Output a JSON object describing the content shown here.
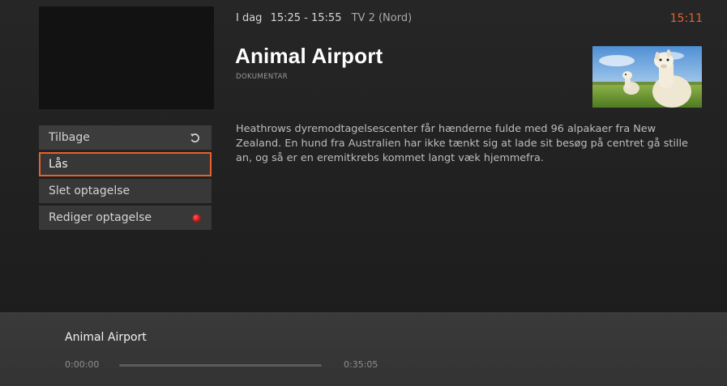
{
  "header": {
    "day": "I dag",
    "time_range": "15:25 - 15:55",
    "channel": "TV 2 (Nord)",
    "clock": "15:11"
  },
  "program": {
    "title": "Animal Airport",
    "genre": "DOKUMENTAR",
    "description": "Heathrows dyremodtagelsescenter får hænderne fulde med 96 alpakaer fra New Zealand. En hund fra Australien har ikke tænkt sig at lade sit besøg på centret gå stille an, og så er en eremitkrebs kommet langt væk hjemmefra."
  },
  "menu": {
    "items": [
      {
        "label": "Tilbage",
        "icon": "back-arrow-icon"
      },
      {
        "label": "Lås",
        "focused": true
      },
      {
        "label": "Slet optagelse"
      },
      {
        "label": "Rediger optagelse",
        "icon": "record-dot-icon"
      }
    ]
  },
  "player": {
    "title": "Animal Airport",
    "time_start": "0:00:00",
    "time_end": "0:35:05",
    "progress": 0
  },
  "colors": {
    "accent": "#e4622d",
    "record": "#d31616"
  }
}
